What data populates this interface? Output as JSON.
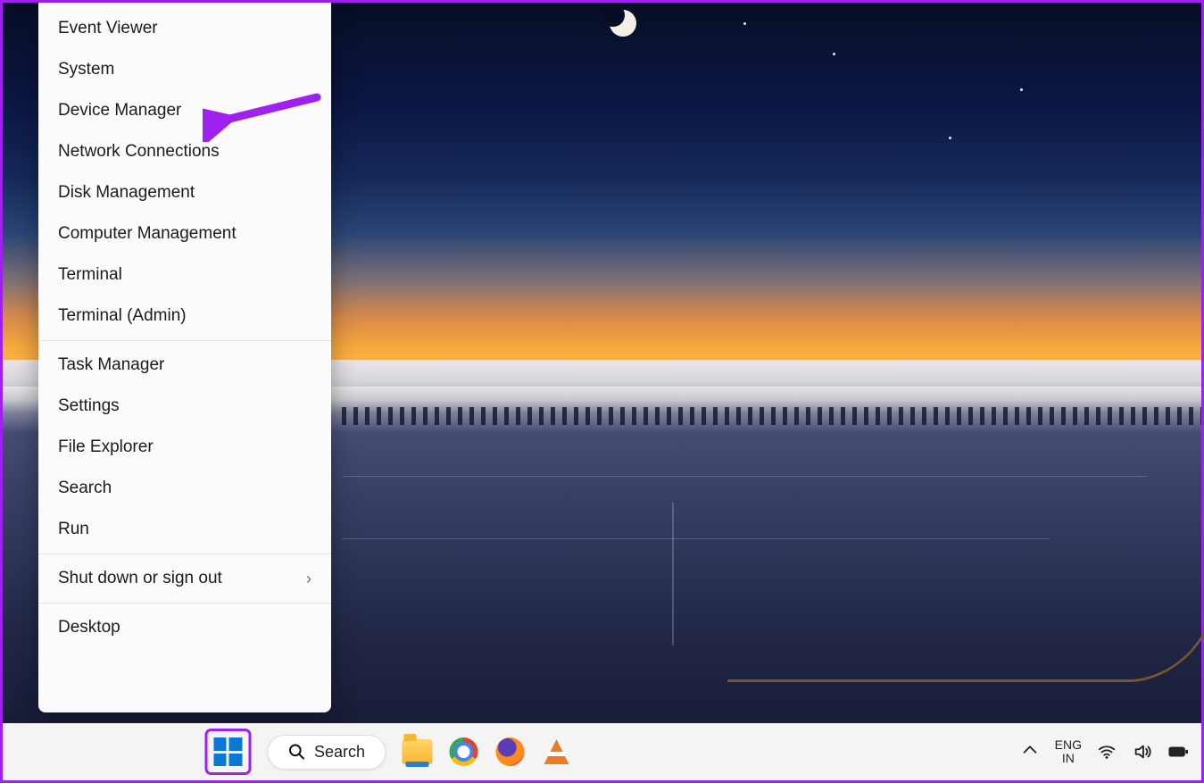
{
  "context_menu": {
    "groups": [
      [
        "Event Viewer",
        "System",
        "Device Manager",
        "Network Connections",
        "Disk Management",
        "Computer Management",
        "Terminal",
        "Terminal (Admin)"
      ],
      [
        "Task Manager",
        "Settings",
        "File Explorer",
        "Search",
        "Run"
      ],
      [
        "Shut down or sign out"
      ],
      [
        "Desktop"
      ]
    ],
    "submenu_item": "Shut down or sign out"
  },
  "annotation": {
    "target": "Device Manager"
  },
  "taskbar": {
    "search_label": "Search",
    "language": {
      "lang": "ENG",
      "region": "IN"
    }
  }
}
